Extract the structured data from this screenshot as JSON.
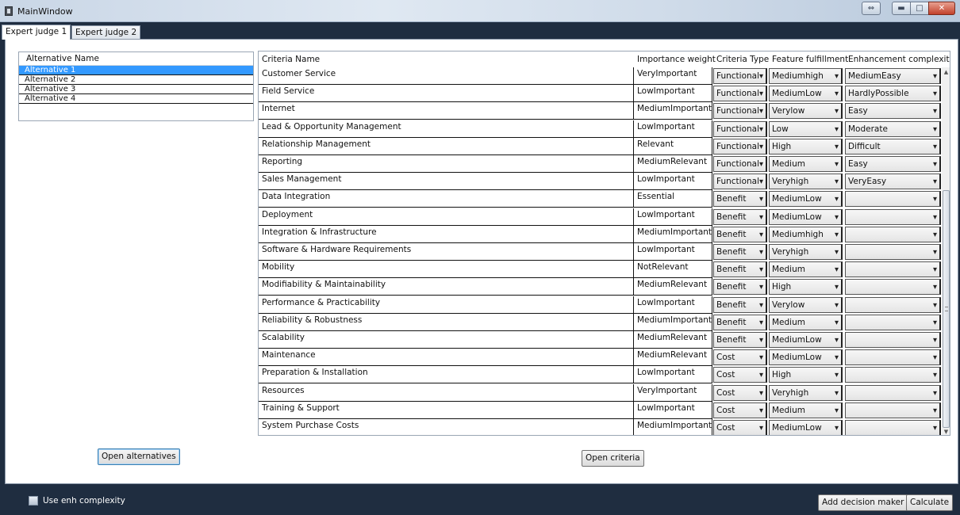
{
  "window": {
    "title": "MainWindow"
  },
  "tabs": [
    {
      "label": "Expert judge 1",
      "active": true
    },
    {
      "label": "Expert judge 2",
      "active": false
    }
  ],
  "alternatives": {
    "header": "Alternative Name",
    "items": [
      "Alternative 1",
      "Alternative 2",
      "Alternative 3",
      "Alternative 4"
    ],
    "selected_index": 0
  },
  "criteria": {
    "headers": [
      "Criteria Name",
      "Importance weight",
      "Criteria Type",
      "Feature fulfillment",
      "Enhancement complexity"
    ],
    "rows": [
      {
        "name": "Customer Service",
        "weight": "VeryImportant",
        "type": "Functional",
        "feature": "Mediumhigh",
        "enhancement": "MediumEasy"
      },
      {
        "name": "Field Service",
        "weight": "LowImportant",
        "type": "Functional",
        "feature": "MediumLow",
        "enhancement": "HardlyPossible"
      },
      {
        "name": "Internet",
        "weight": "MediumImportant",
        "type": "Functional",
        "feature": "Verylow",
        "enhancement": "Easy"
      },
      {
        "name": "Lead & Opportunity Management",
        "weight": "LowImportant",
        "type": "Functional",
        "feature": "Low",
        "enhancement": "Moderate"
      },
      {
        "name": "Relationship Management",
        "weight": "Relevant",
        "type": "Functional",
        "feature": "High",
        "enhancement": "Difficult"
      },
      {
        "name": "Reporting",
        "weight": "MediumRelevant",
        "type": "Functional",
        "feature": "Medium",
        "enhancement": "Easy"
      },
      {
        "name": "Sales Management",
        "weight": "LowImportant",
        "type": "Functional",
        "feature": "Veryhigh",
        "enhancement": "VeryEasy"
      },
      {
        "name": "Data Integration",
        "weight": "Essential",
        "type": "Benefit",
        "feature": "MediumLow",
        "enhancement": ""
      },
      {
        "name": "Deployment",
        "weight": "LowImportant",
        "type": "Benefit",
        "feature": "MediumLow",
        "enhancement": ""
      },
      {
        "name": "Integration & Infrastructure",
        "weight": "MediumImportant",
        "type": "Benefit",
        "feature": "Mediumhigh",
        "enhancement": ""
      },
      {
        "name": "Software & Hardware Requirements",
        "weight": "LowImportant",
        "type": "Benefit",
        "feature": "Veryhigh",
        "enhancement": ""
      },
      {
        "name": "Mobility",
        "weight": "NotRelevant",
        "type": "Benefit",
        "feature": "Medium",
        "enhancement": ""
      },
      {
        "name": "Modifiability & Maintainability",
        "weight": "MediumRelevant",
        "type": "Benefit",
        "feature": "High",
        "enhancement": ""
      },
      {
        "name": "Performance & Practicability",
        "weight": "LowImportant",
        "type": "Benefit",
        "feature": "Verylow",
        "enhancement": ""
      },
      {
        "name": "Reliability & Robustness",
        "weight": "MediumImportant",
        "type": "Benefit",
        "feature": "Medium",
        "enhancement": ""
      },
      {
        "name": "Scalability",
        "weight": "MediumRelevant",
        "type": "Benefit",
        "feature": "MediumLow",
        "enhancement": ""
      },
      {
        "name": "Maintenance",
        "weight": "MediumRelevant",
        "type": "Cost",
        "feature": "MediumLow",
        "enhancement": ""
      },
      {
        "name": "Preparation & Installation",
        "weight": "LowImportant",
        "type": "Cost",
        "feature": "High",
        "enhancement": ""
      },
      {
        "name": "Resources",
        "weight": "VeryImportant",
        "type": "Cost",
        "feature": "Veryhigh",
        "enhancement": ""
      },
      {
        "name": "Training & Support",
        "weight": "LowImportant",
        "type": "Cost",
        "feature": "Medium",
        "enhancement": ""
      },
      {
        "name": "System Purchase Costs",
        "weight": "MediumImportant",
        "type": "Cost",
        "feature": "MediumLow",
        "enhancement": ""
      }
    ]
  },
  "buttons": {
    "open_alternatives": "Open alternatives",
    "open_criteria": "Open criteria",
    "add_decision_maker": "Add decision maker",
    "calculate": "Calculate"
  },
  "options": {
    "use_enh_complexity_label": "Use enh complexity",
    "use_enh_complexity_checked": false
  },
  "colors": {
    "chrome": "#1f2d40",
    "selection": "#3399ff"
  }
}
